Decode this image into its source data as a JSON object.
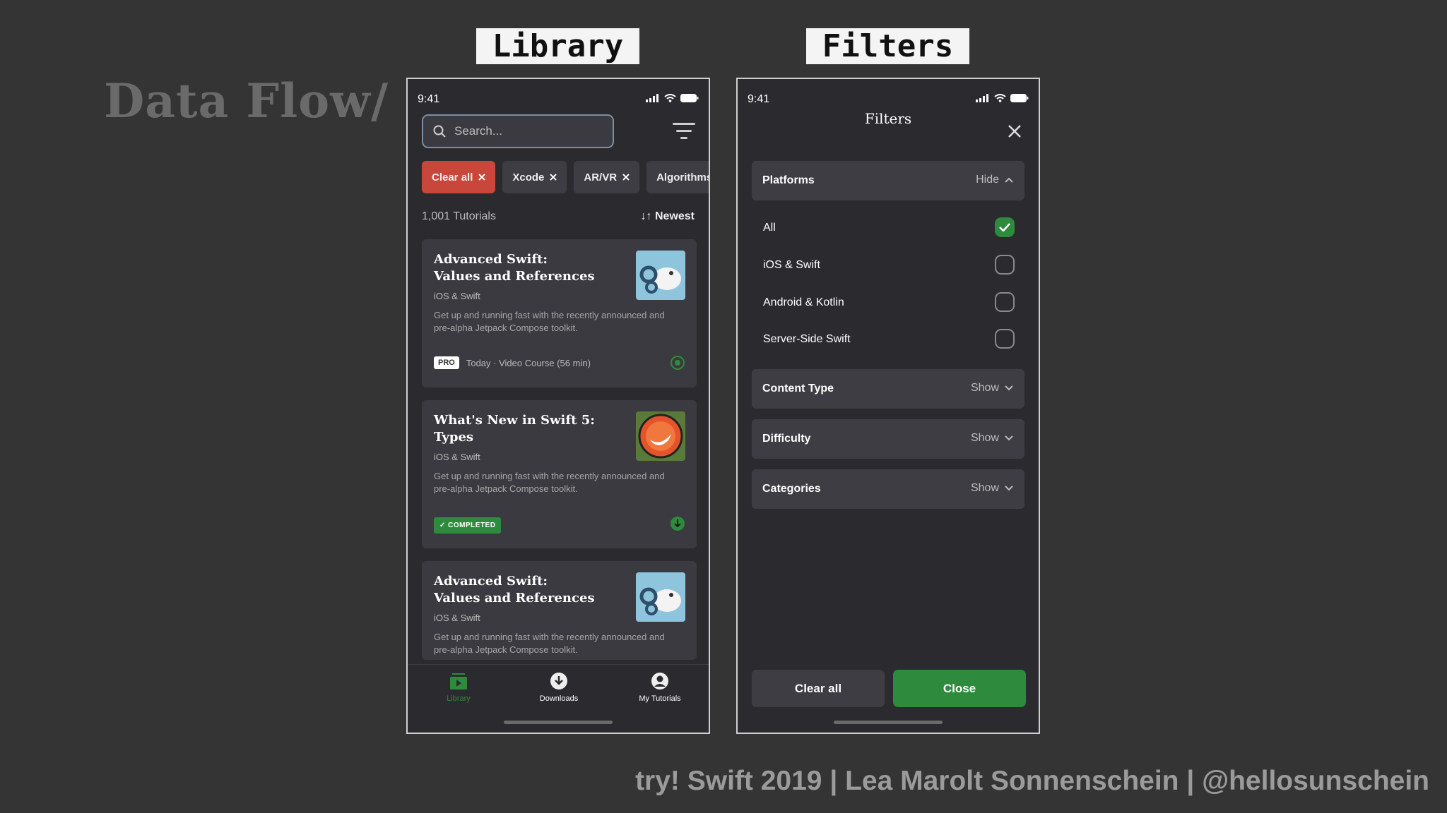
{
  "slide": {
    "title": "Data Flow/",
    "footer": "try! Swift 2019 | Lea Marolt Sonnenschein | @hellosunschein",
    "label_library": "Library",
    "label_filters": "Filters"
  },
  "library": {
    "status_time": "9:41",
    "search_placeholder": "Search...",
    "chips": [
      {
        "label": "Clear all"
      },
      {
        "label": "Xcode"
      },
      {
        "label": "AR/VR"
      },
      {
        "label": "Algorithms"
      }
    ],
    "count": "1,001 Tutorials",
    "sort": "Newest",
    "cards": [
      {
        "title": "Advanced Swift: Values and References",
        "subtitle": "iOS & Swift",
        "description": "Get up and running fast with the recently announced and pre-alpha Jetpack Compose toolkit.",
        "badge": "PRO",
        "meta": "Today · Video Course (56 min)"
      },
      {
        "title": "What's New in Swift 5: Types",
        "subtitle": "iOS & Swift",
        "description": "Get up and running fast with the recently announced and pre-alpha Jetpack Compose toolkit.",
        "badge": "COMPLETED"
      },
      {
        "title": "Advanced Swift: Values and References",
        "subtitle": "iOS & Swift",
        "description": "Get up and running fast with the recently announced and pre-alpha Jetpack Compose toolkit."
      }
    ],
    "tabs": [
      {
        "label": "Library"
      },
      {
        "label": "Downloads"
      },
      {
        "label": "My Tutorials"
      }
    ]
  },
  "filters": {
    "status_time": "9:41",
    "title": "Filters",
    "platforms": {
      "name": "Platforms",
      "toggle": "Hide",
      "options": [
        {
          "label": "All",
          "checked": true
        },
        {
          "label": "iOS & Swift",
          "checked": false
        },
        {
          "label": "Android & Kotlin",
          "checked": false
        },
        {
          "label": "Server-Side Swift",
          "checked": false
        }
      ]
    },
    "sections": [
      {
        "name": "Content Type",
        "toggle": "Show"
      },
      {
        "name": "Difficulty",
        "toggle": "Show"
      },
      {
        "name": "Categories",
        "toggle": "Show"
      }
    ],
    "clear_label": "Clear all",
    "close_label": "Close"
  },
  "colors": {
    "accent_green": "#2e8b3d",
    "chip_red": "#c8473a",
    "background": "#343434"
  }
}
